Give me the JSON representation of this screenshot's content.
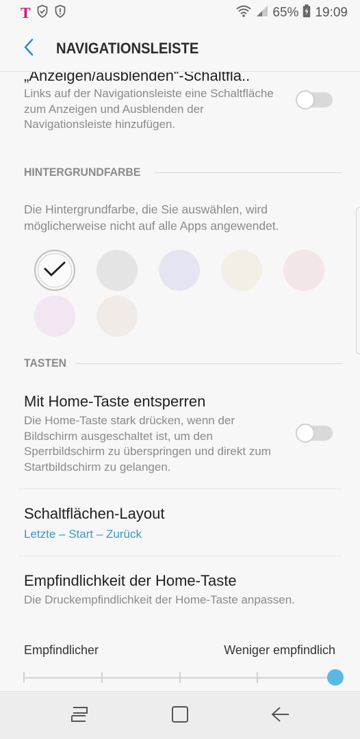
{
  "status_bar": {
    "carrier_logo": "T",
    "battery": "65%",
    "time": "19:09",
    "icons": [
      "shield-check-icon",
      "shield-alert-icon",
      "wifi-icon",
      "signal-icon",
      "battery-charging-icon"
    ]
  },
  "header": {
    "title": "NAVIGATIONSLEISTE",
    "back_icon": "chevron-left-icon"
  },
  "show_hide_button": {
    "title": "„Anzeigen/ausblenden“-Schaltfla..",
    "summary": "Links auf der Navigationsleiste eine Schaltfläche zum Anzeigen und Ausblenden der Navigationsleiste hinzufügen.",
    "enabled": false
  },
  "background_section": {
    "header": "HINTERGRUNDFARBE",
    "description": "Die Hintergrundfarbe, die Sie auswählen, wird möglicherweise nicht auf alle Apps angewendet.",
    "swatches": [
      {
        "color": "#f7f7f7",
        "selected": true
      },
      {
        "color": "#e4e4e4",
        "selected": false
      },
      {
        "color": "#e4e4f2",
        "selected": false
      },
      {
        "color": "#f3efe7",
        "selected": false
      },
      {
        "color": "#f3e6e6",
        "selected": false
      },
      {
        "color": "#f1e6f1",
        "selected": false
      },
      {
        "color": "#f0ebe6",
        "selected": false
      }
    ]
  },
  "keys_section": {
    "header": "TASTEN",
    "unlock_home": {
      "title": "Mit Home-Taste entsperren",
      "summary": "Die Home-Taste stark drücken, wenn der Bildschirm ausgeschaltet ist, um den Sperrbildschirm zu überspringen und direkt zum Startbildschirm zu gelangen.",
      "enabled": false
    },
    "button_layout": {
      "title": "Schaltflächen-Layout",
      "value": "Letzte – Start – Zurück"
    },
    "sensitivity": {
      "title": "Empfindlichkeit der Home-Taste",
      "summary": "Die Druckempfindlichkeit der Home-Taste anpassen.",
      "min_label": "Empfindlicher",
      "max_label": "Weniger empfindlich",
      "steps": 5,
      "level": 5
    }
  },
  "colors": {
    "accent": "#3a97c9",
    "slider_thumb": "#5ab8e6",
    "carrier": "#e20074"
  },
  "nav_bar": {
    "icons": [
      "recent-apps-icon",
      "home-icon",
      "back-icon"
    ]
  }
}
